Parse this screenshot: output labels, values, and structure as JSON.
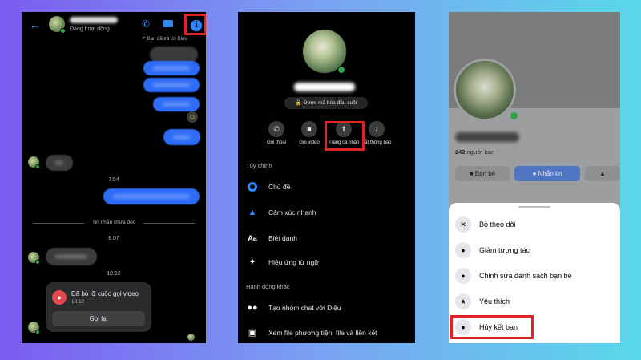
{
  "chat": {
    "status": "Đang hoạt động",
    "reply_note": "Bạn đã trả lời Diệu",
    "times": [
      "7:54",
      "8:07",
      "10:12"
    ],
    "unread_label": "Tin nhắn chưa đọc",
    "missed_call": {
      "title": "Đã bỏ lỡ cuộc gọi video",
      "time": "10:12",
      "action": "Gọi lại"
    },
    "icons": {
      "back": "back-arrow-icon",
      "call": "phone-icon",
      "video": "video-camera-icon",
      "info": "info-icon"
    },
    "accent": "#2d88ff",
    "highlight": "#e02424"
  },
  "thread": {
    "encryption": "Được mã hóa đầu cuối",
    "actions": [
      {
        "label": "Gọi thoại",
        "icon": "phone-icon"
      },
      {
        "label": "Gọi video",
        "icon": "video-camera-icon"
      },
      {
        "label": "Trang cá nhân",
        "icon": "facebook-icon"
      },
      {
        "label": "Tắt thông báo",
        "icon": "bell-icon"
      }
    ],
    "customize_header": "Tùy chỉnh",
    "customize": [
      {
        "label": "Chủ đề",
        "icon": "theme-icon"
      },
      {
        "label": "Cảm xúc nhanh",
        "icon": "thumbs-up-icon"
      },
      {
        "label": "Biệt danh",
        "icon": "nickname-icon"
      },
      {
        "label": "Hiệu ứng từ ngữ",
        "icon": "word-effects-icon"
      }
    ],
    "other_header": "Hành động khác",
    "other": [
      {
        "label": "Tạo nhóm chat với Diệu",
        "icon": "group-icon"
      },
      {
        "label": "Xem file phương tiện, file và liên kết",
        "icon": "media-icon"
      }
    ]
  },
  "profile": {
    "friends_count": "242",
    "friends_suffix": "người bạn",
    "btn_friends": "Bạn bè",
    "btn_message": "Nhắn tin",
    "sheet": [
      {
        "label": "Bỏ theo dõi",
        "icon": "unfollow-icon"
      },
      {
        "label": "Giảm tương tác",
        "icon": "reduce-interaction-icon"
      },
      {
        "label": "Chỉnh sửa danh sách bạn bè",
        "icon": "edit-friends-icon"
      },
      {
        "label": "Yêu thích",
        "icon": "star-icon"
      },
      {
        "label": "Hủy kết bạn",
        "icon": "unfriend-icon"
      }
    ]
  }
}
